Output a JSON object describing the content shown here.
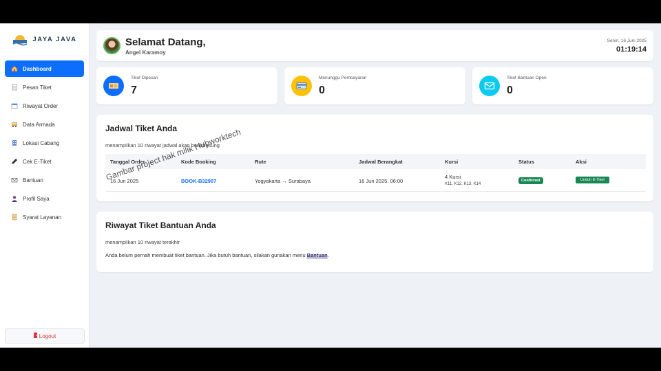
{
  "brand": {
    "name": "JAYA JAVA"
  },
  "sidebar": {
    "items": [
      {
        "label": "Dashboard",
        "icon": "house-icon",
        "active": true
      },
      {
        "label": "Pesan Tiket",
        "icon": "document-icon"
      },
      {
        "label": "Riwayat Order",
        "icon": "calendar-icon"
      },
      {
        "label": "Data Armada",
        "icon": "bus-icon"
      },
      {
        "label": "Lokasi Cabang",
        "icon": "building-icon"
      },
      {
        "label": "Cek E-Tiket",
        "icon": "pen-icon"
      },
      {
        "label": "Bantuan",
        "icon": "envelope-icon"
      },
      {
        "label": "Profil Saya",
        "icon": "user-icon"
      },
      {
        "label": "Syarat Layanan",
        "icon": "scroll-icon"
      }
    ],
    "logout_label": "Logout"
  },
  "welcome": {
    "title": "Selamat Datang,",
    "name": "Angel Karamoy",
    "date": "Senin, 16 Juni 2025",
    "time": "01:19:14"
  },
  "stats": [
    {
      "label": "Tiket Dipesan",
      "value": "7",
      "color": "#0d6efd",
      "icon": "ticket-icon"
    },
    {
      "label": "Menunggu Pembayaran",
      "value": "0",
      "color": "#ffc107",
      "icon": "card-icon"
    },
    {
      "label": "Tiket Bantuan Open",
      "value": "0",
      "color": "#0dcaf0",
      "icon": "envelope-icon"
    }
  ],
  "schedule": {
    "title": "Jadwal Tiket Anda",
    "subtitle": "menampilkan 10 riwayat jadwal akan berlangsung",
    "headers": [
      "Tanggal Order",
      "Kode Booking",
      "Rute",
      "Jadwal Berangkat",
      "Kursi",
      "Status",
      "Aksi"
    ],
    "rows": [
      {
        "date": "16 Jun 2025",
        "code": "BOOK-B32907",
        "route": "Yogyakarta → Surabaya",
        "departure": "16 Jun 2025, 06:00",
        "seats": "4 Kursi",
        "seat_list": "K11, K12, K13, K14",
        "status": "Confirmed",
        "action": "Unduh E-Tiket"
      }
    ]
  },
  "helpdesk": {
    "title": "Riwayat Tiket Bantuan Anda",
    "subtitle": "menampilkan 10 riwayat terakhir",
    "message": "Anda belum pernah membuat tiket bantuan. Jika butuh bantuan, silakan gunakan menu ",
    "link": "Bantuan",
    "suffix": "."
  },
  "watermark": "Gambar project hak milik Hubworktech",
  "colors": {
    "primary": "#0d6efd",
    "success": "#198754",
    "danger": "#dc3545"
  }
}
